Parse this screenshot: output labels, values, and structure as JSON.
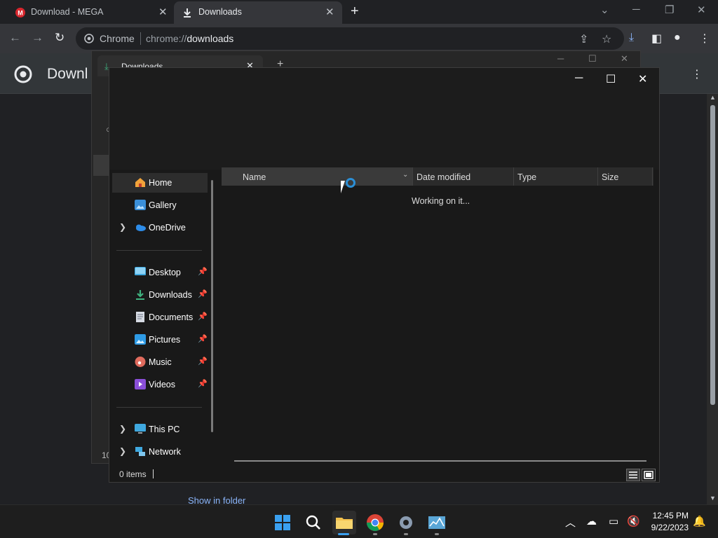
{
  "browser": {
    "tabs": [
      {
        "title": "Download - MEGA"
      },
      {
        "title": "Downloads"
      }
    ],
    "omnibox": {
      "site": "Chrome",
      "url_prefix": "chrome://",
      "url_main": "downloads"
    },
    "page_title": "Downl",
    "show_in_folder": "Show in folder",
    "colors": {
      "accent": "#8ab4f8",
      "mega": "#d9272e"
    }
  },
  "ghost_tab": {
    "title": "Downloads"
  },
  "ghost_left": {
    "count": "10"
  },
  "dialog": {
    "nav": {
      "home": "Home",
      "gallery": "Gallery",
      "onedrive": "OneDrive",
      "desktop": "Desktop",
      "downloads": "Downloads",
      "documents": "Documents",
      "pictures": "Pictures",
      "music": "Music",
      "videos": "Videos",
      "thispc": "This PC",
      "network": "Network"
    },
    "columns": {
      "name": "Name",
      "date": "Date modified",
      "type": "Type",
      "size": "Size"
    },
    "status_message": "Working on it...",
    "status_bar": "0 items"
  },
  "taskbar": {
    "apps": [
      "start-icon",
      "search-icon",
      "file-explorer-icon",
      "chrome-icon",
      "settings-icon",
      "task-manager-icon"
    ],
    "time": "12:45 PM",
    "date": "9/22/2023"
  }
}
